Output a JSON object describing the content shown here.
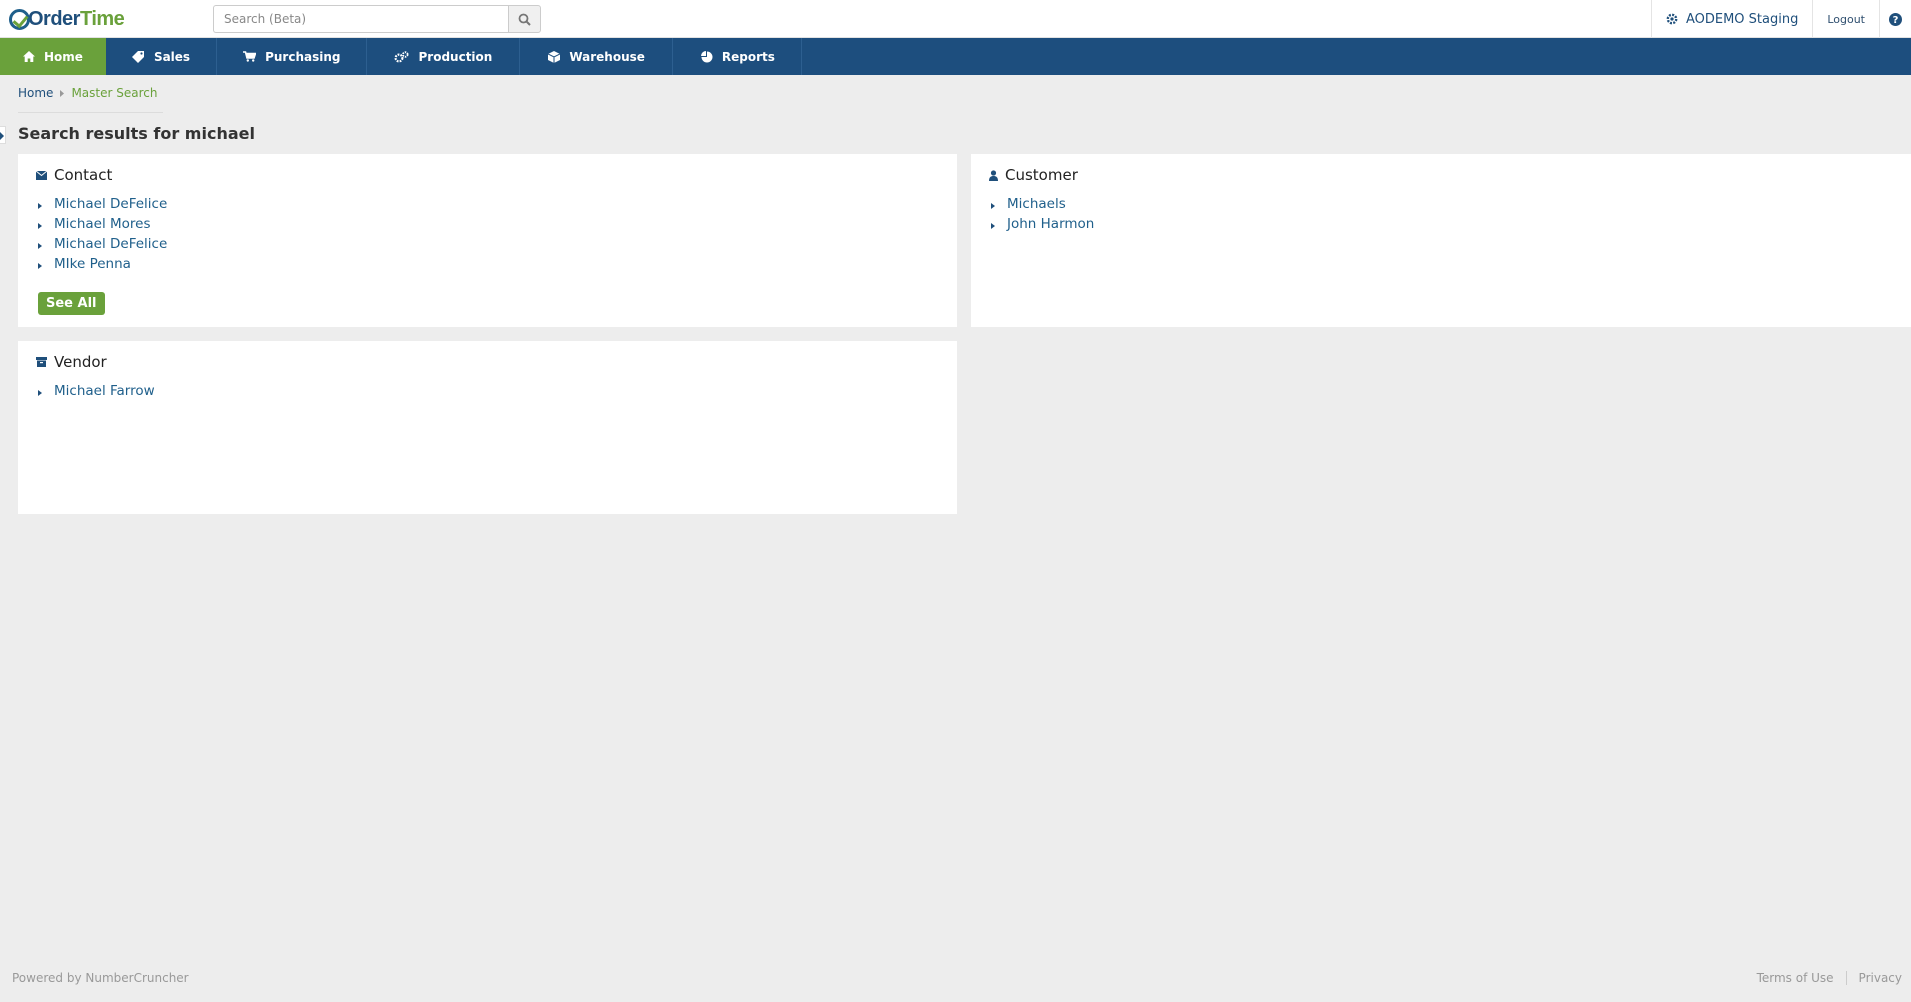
{
  "app": {
    "logo_part1": "Order",
    "logo_part2": "Time",
    "search_placeholder": "Search (Beta)",
    "company": "AODEMO Staging",
    "logout": "Logout"
  },
  "nav": [
    {
      "label": "Home",
      "icon": "home-icon",
      "active": true
    },
    {
      "label": "Sales",
      "icon": "tag-icon"
    },
    {
      "label": "Purchasing",
      "icon": "cart-icon"
    },
    {
      "label": "Production",
      "icon": "gears-icon"
    },
    {
      "label": "Warehouse",
      "icon": "box-icon"
    },
    {
      "label": "Reports",
      "icon": "pie-chart-icon"
    }
  ],
  "breadcrumb": {
    "home": "Home",
    "current": "Master Search"
  },
  "page_title": "Search results for michael",
  "panels": {
    "contact": {
      "title": "Contact",
      "items": [
        "Michael DeFelice",
        "Michael Mores",
        "Michael DeFelice",
        "MIke Penna"
      ],
      "see_all": "See All"
    },
    "customer": {
      "title": "Customer",
      "items": [
        "Michaels",
        "John Harmon"
      ]
    },
    "vendor": {
      "title": "Vendor",
      "items": [
        "Michael Farrow"
      ]
    }
  },
  "footer": {
    "powered": "Powered by NumberCruncher",
    "terms": "Terms of Use",
    "privacy": "Privacy"
  },
  "colors": {
    "nav_bg": "#1d4e7e",
    "accent_green": "#6aa13b",
    "link_blue": "#1f5f8b"
  }
}
